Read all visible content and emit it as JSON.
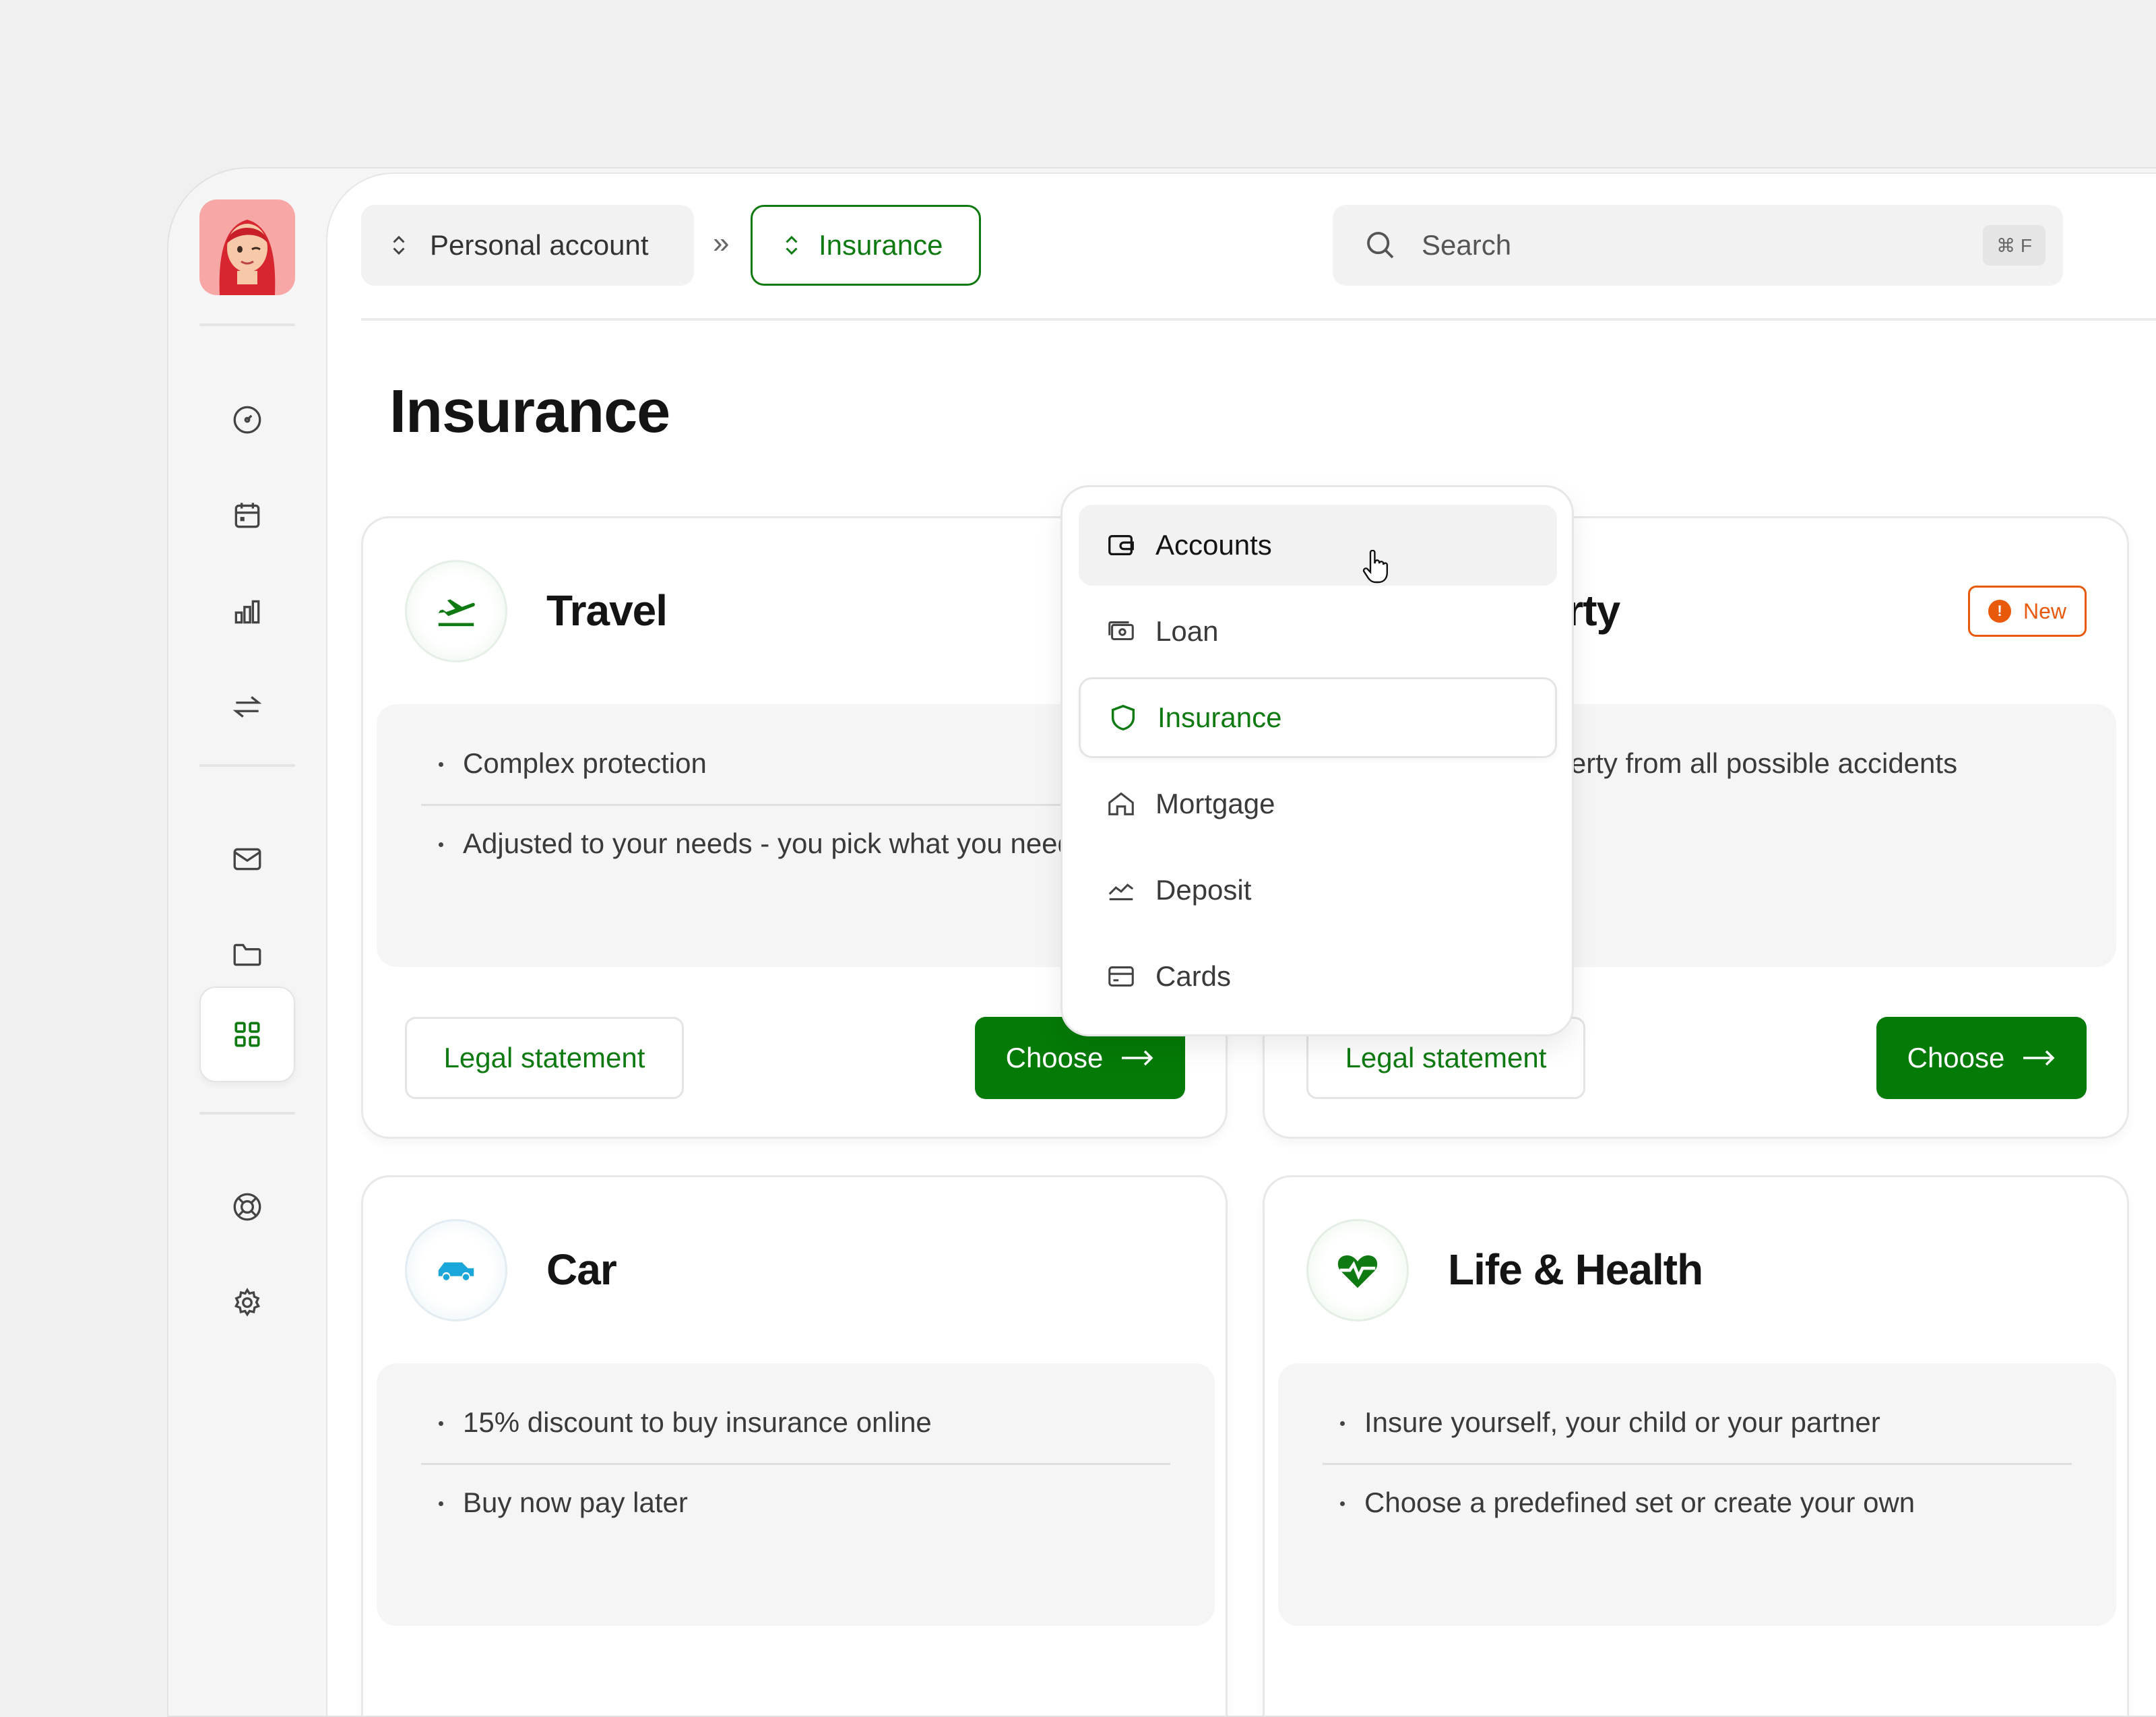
{
  "breadcrumb": {
    "account_label": "Personal account",
    "separator": "»",
    "section_label": "Insurance"
  },
  "search": {
    "placeholder": "Search",
    "shortcut": "⌘ F"
  },
  "page": {
    "title": "Insurance"
  },
  "sidebar": {
    "icons": [
      "dashboard-icon",
      "calendar-icon",
      "chart-icon",
      "transfer-icon",
      "mail-icon",
      "folder-icon",
      "apps-icon",
      "help-icon",
      "settings-icon"
    ],
    "active": "apps-icon"
  },
  "dropdown": {
    "items": [
      {
        "label": "Accounts",
        "icon": "wallet-icon"
      },
      {
        "label": "Loan",
        "icon": "cash-icon"
      },
      {
        "label": "Insurance",
        "icon": "shield-icon"
      },
      {
        "label": "Mortgage",
        "icon": "home-icon"
      },
      {
        "label": "Deposit",
        "icon": "growth-icon"
      },
      {
        "label": "Cards",
        "icon": "card-icon"
      }
    ],
    "hovered": "Accounts",
    "selected": "Insurance"
  },
  "cards": [
    {
      "title": "Travel",
      "icon": "plane-departure-icon",
      "bullets": [
        "Complex protection",
        "Adjusted to your needs - you pick what you need"
      ],
      "legal_label": "Legal statement",
      "choose_label": "Choose"
    },
    {
      "title": "Property",
      "icon": "house-icon",
      "badge": "New",
      "bullets": [
        "Insure your property from all possible accidents and sleep tight"
      ],
      "legal_label": "Legal statement",
      "choose_label": "Choose"
    },
    {
      "title": "Car",
      "icon": "car-icon",
      "bullets": [
        "15% discount to buy insurance online",
        "Buy now pay later"
      ]
    },
    {
      "title": "Life & Health",
      "icon": "heart-pulse-icon",
      "bullets": [
        "Insure yourself, your child or your partner",
        "Choose a predefined set or create your own"
      ]
    }
  ],
  "colors": {
    "accent": "#047a07",
    "badge": "#e8590c",
    "background": "#f0f0f0"
  }
}
